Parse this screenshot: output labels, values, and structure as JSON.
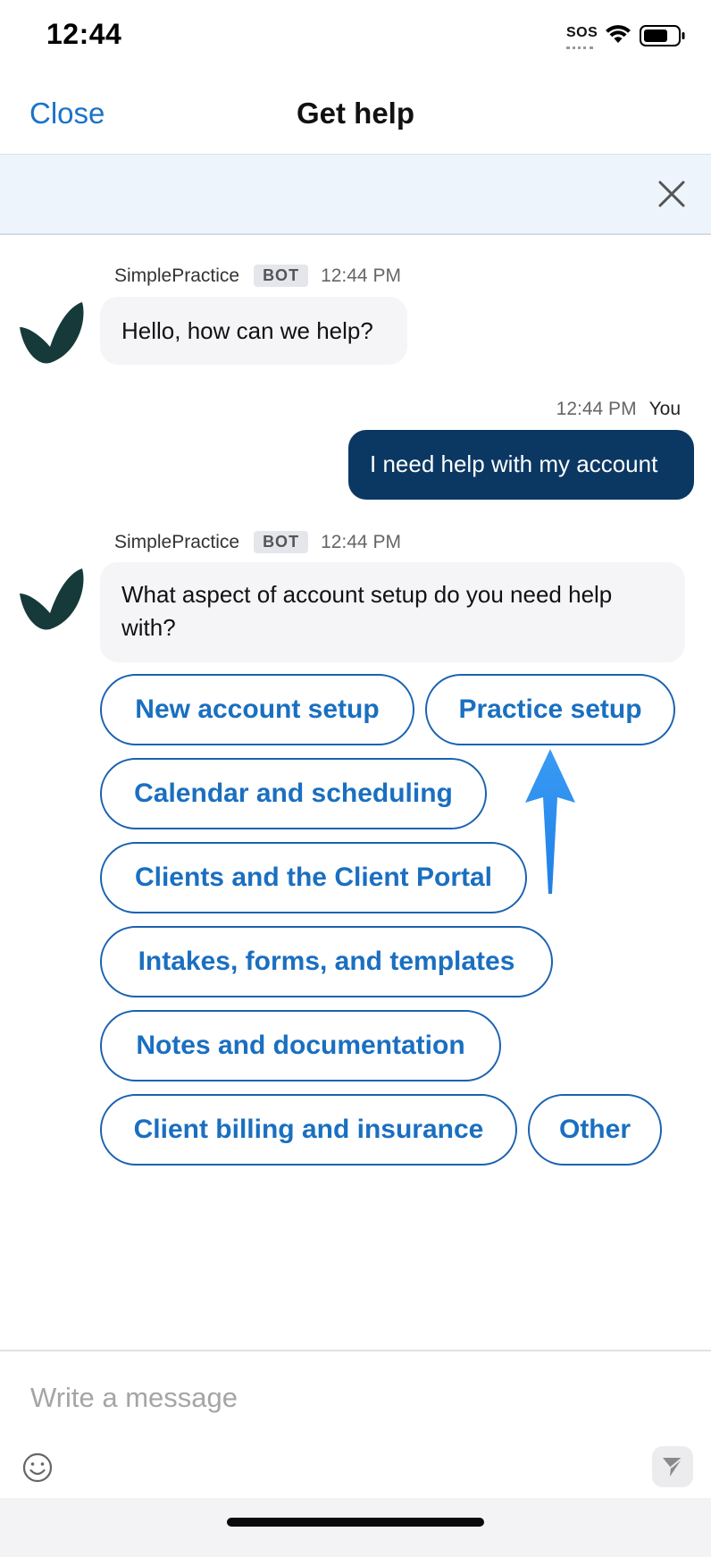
{
  "status_bar": {
    "time": "12:44",
    "sos": "SOS",
    "icons": [
      "wifi-icon",
      "battery-icon"
    ]
  },
  "header": {
    "close_label": "Close",
    "title": "Get help"
  },
  "banner": {
    "close_icon": "close-icon"
  },
  "messages": [
    {
      "sender": "SimplePractice",
      "badge": "BOT",
      "time": "12:44 PM",
      "text": "Hello, how can we help?"
    },
    {
      "sender": "You",
      "time": "12:44 PM",
      "text": "I need help with my account"
    },
    {
      "sender": "SimplePractice",
      "badge": "BOT",
      "time": "12:44 PM",
      "text": "What aspect of account setup do you need help with?"
    }
  ],
  "options": [
    "New account setup",
    "Practice setup",
    "Calendar and scheduling",
    "Clients and the Client Portal",
    "Intakes, forms, and templates",
    "Notes and documentation",
    "Client billing and insurance",
    "Other"
  ],
  "composer": {
    "placeholder": "Write a message",
    "value": "",
    "emoji_icon": "emoji-icon",
    "send_icon": "send-icon"
  },
  "colors": {
    "accent": "#1a73c8",
    "chip_border": "#1a62b0",
    "user_bubble": "#0b3863",
    "bot_bubble": "#f5f5f8",
    "banner_bg": "#eef4fb",
    "annotation_arrow": "#2b8ef0",
    "avatar": "#163a3a"
  }
}
